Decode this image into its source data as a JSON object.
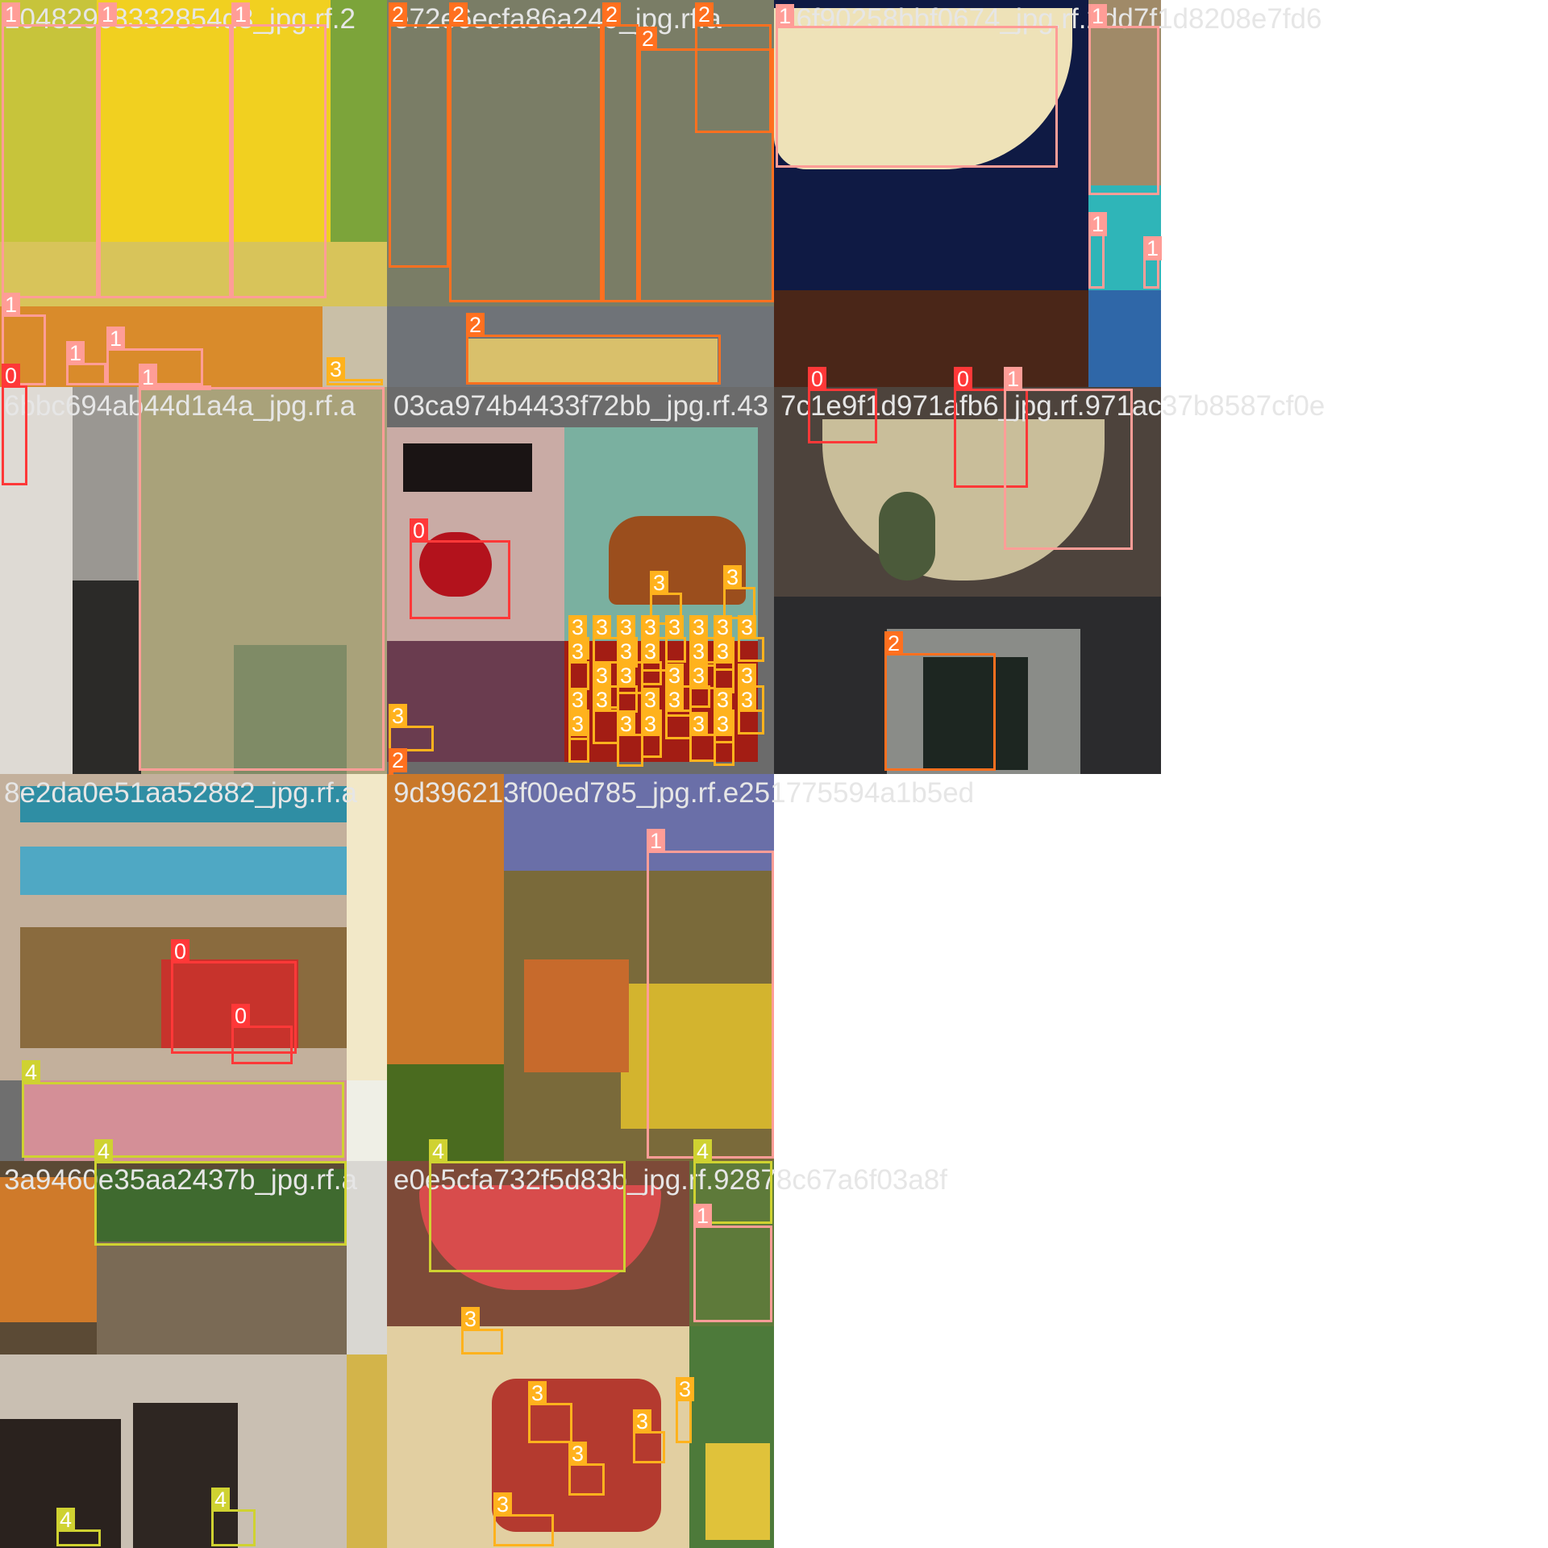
{
  "mosaic": {
    "tiles": [
      {
        "filename": "104829c8332854d3_jpg.rf.2"
      },
      {
        "filename": "e72e6ecfa86a249_jpg.rf.a"
      },
      {
        "filename": "76f90258bbf0674_jpg.rf.2dd7f1d8208e7fd6"
      },
      {
        "filename": "6bbc694ab44d1a4a_jpg.rf.a"
      },
      {
        "filename": "03ca974b4433f72bb_jpg.rf.43"
      },
      {
        "filename": "7c1e9f1d971afb6_jpg.rf.971ac37b8587cf0e"
      },
      {
        "filename": "8e2da0e51aa52882_jpg.rf.a"
      },
      {
        "filename": "9d396213f00ed785_jpg.rf.e251775594a1b5ed"
      },
      {
        "filename": "3a9460e35aa2437b_jpg.rf.a"
      },
      {
        "filename": "e0e5cfa732f5d83b_jpg.rf.92878c67a6f03a8f"
      }
    ],
    "label_colors": {
      "0": "#ff3838",
      "1": "#ff9d97",
      "2": "#ff701f",
      "3": "#ffb21d",
      "4": "#cfd231"
    },
    "boxes": [
      {
        "label": "1"
      },
      {
        "label": "1"
      },
      {
        "label": "1"
      },
      {
        "label": "1"
      },
      {
        "label": "1"
      },
      {
        "label": "1"
      },
      {
        "label": "0"
      },
      {
        "label": "1"
      },
      {
        "label": "3"
      },
      {
        "label": "2"
      },
      {
        "label": "2"
      },
      {
        "label": "2"
      },
      {
        "label": "2"
      },
      {
        "label": "2"
      },
      {
        "label": "2"
      },
      {
        "label": "1"
      },
      {
        "label": "1"
      },
      {
        "label": "1"
      },
      {
        "label": "1"
      },
      {
        "label": "1"
      },
      {
        "label": "0"
      },
      {
        "label": "3"
      },
      {
        "label": "3"
      },
      {
        "label": "3"
      },
      {
        "label": "2"
      },
      {
        "label": "0"
      },
      {
        "label": "0"
      },
      {
        "label": "1"
      },
      {
        "label": "2"
      },
      {
        "label": "0"
      },
      {
        "label": "0"
      },
      {
        "label": "4"
      },
      {
        "label": "4"
      },
      {
        "label": "1"
      },
      {
        "label": "4"
      },
      {
        "label": "4"
      },
      {
        "label": "1"
      },
      {
        "label": "4"
      },
      {
        "label": "4"
      },
      {
        "label": "3"
      },
      {
        "label": "3"
      },
      {
        "label": "3"
      },
      {
        "label": "3"
      },
      {
        "label": "3"
      },
      {
        "label": "3"
      }
    ],
    "dense_label": "3"
  }
}
